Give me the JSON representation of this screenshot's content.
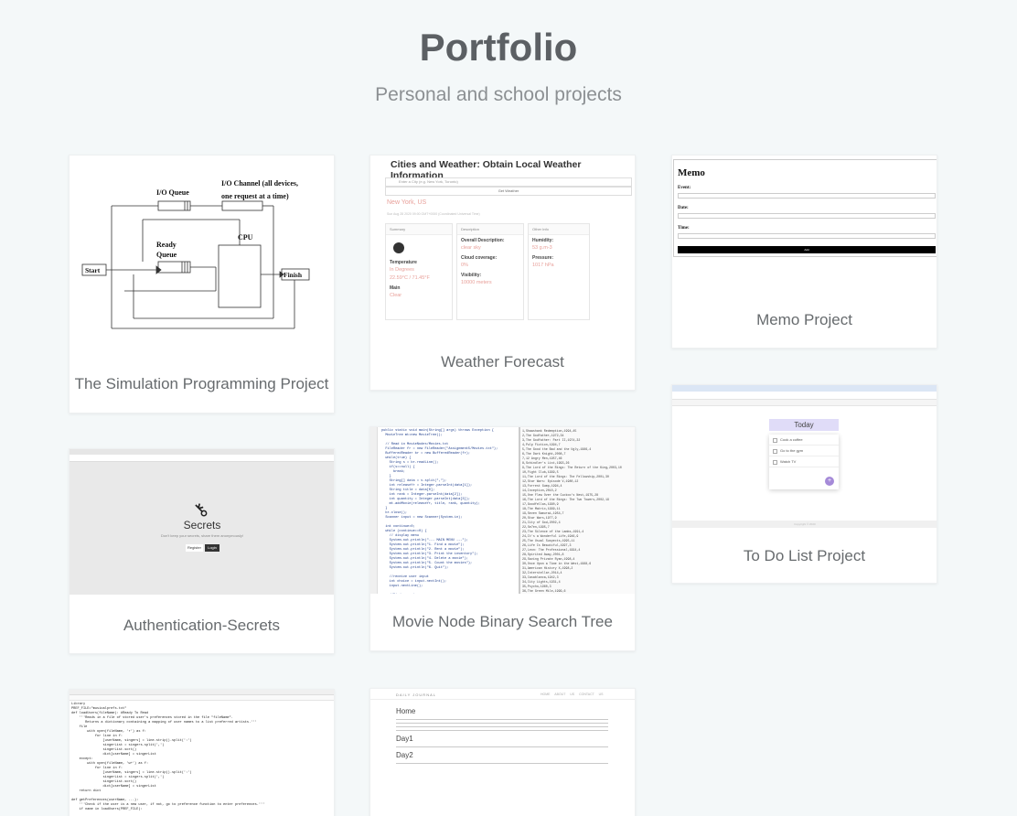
{
  "header": {
    "title": "Portfolio",
    "subtitle": "Personal and school projects"
  },
  "projects": [
    {
      "caption": "The Simulation Programming Project",
      "diagram": {
        "io_queue": "I/O Queue",
        "io_channel_1": "I/O Channel (all devices,",
        "io_channel_2": "one request at a time)",
        "ready_1": "Ready",
        "ready_2": "Queue",
        "cpu": "CPU",
        "start": "Start",
        "finish": "Finish"
      }
    },
    {
      "caption": "Weather Forecast",
      "weather": {
        "title": "Cities and Weather: Obtain Local Weather Information",
        "input_placeholder": "Enter a City (e.g. New York, Toronto)",
        "button": "Get Weather",
        "city": "New York, US",
        "updated": "Sun Aug 28 2020 09:00 GMT+0000 (Coordinated Universal Time)",
        "summary": {
          "header": "Summary",
          "temp_label": "Temperature",
          "temp_value_1": "In Degrees",
          "temp_value_2": "22.59°C / 71.45°F",
          "main_label": "Main",
          "main_value": "Clear"
        },
        "description": {
          "header": "Description",
          "overall_label": "Overall Description:",
          "overall_value": "clear sky",
          "cloud_label": "Cloud coverage:",
          "cloud_value": "0%",
          "visibility_label": "Visibility:",
          "visibility_value": "10000 meters"
        },
        "other": {
          "header": "Other Info",
          "humidity_label": "Humidity:",
          "humidity_value": "53 g.m-3",
          "pressure_label": "Pressure:",
          "pressure_value": "1017 hPa"
        }
      }
    },
    {
      "caption": "Memo Project",
      "memo": {
        "title": "Memo",
        "event_label": "Event:",
        "date_label": "Date:",
        "time_label": "Time:",
        "button": "Add"
      }
    },
    {
      "caption": "Authentication-Secrets",
      "secrets": {
        "title": "Secrets",
        "subtitle": "Don't keep your secrets, share them anonymously!",
        "register": "Register",
        "login": "Login"
      }
    },
    {
      "caption": "Movie Node Binary Search Tree"
    },
    {
      "caption": "To Do List Project",
      "todo": {
        "heading": "Today",
        "items": [
          "Cook a coffee",
          "Go to the gym",
          "Watch TV"
        ],
        "add": "+",
        "footer": "Copyright © 2020"
      }
    },
    {
      "caption": ""
    },
    {
      "caption": "",
      "journal": {
        "brand": "DAILY JOURNAL",
        "nav": "HOME  ABOUT US  CONTACT US",
        "home": "Home",
        "day1": "Day1",
        "day2": "Day2"
      }
    }
  ]
}
